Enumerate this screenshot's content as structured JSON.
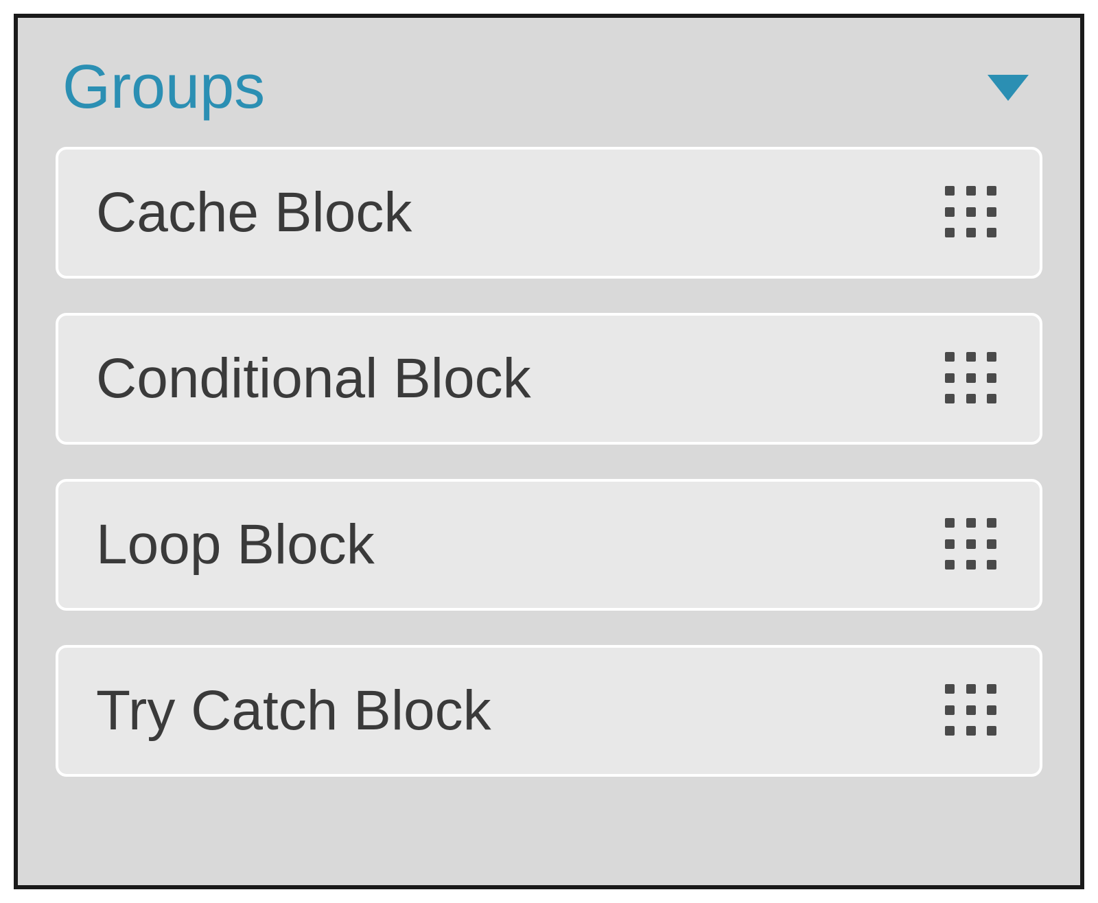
{
  "panel": {
    "title": "Groups",
    "items": [
      {
        "label": "Cache Block"
      },
      {
        "label": "Conditional Block"
      },
      {
        "label": "Loop Block"
      },
      {
        "label": "Try Catch Block"
      }
    ]
  }
}
